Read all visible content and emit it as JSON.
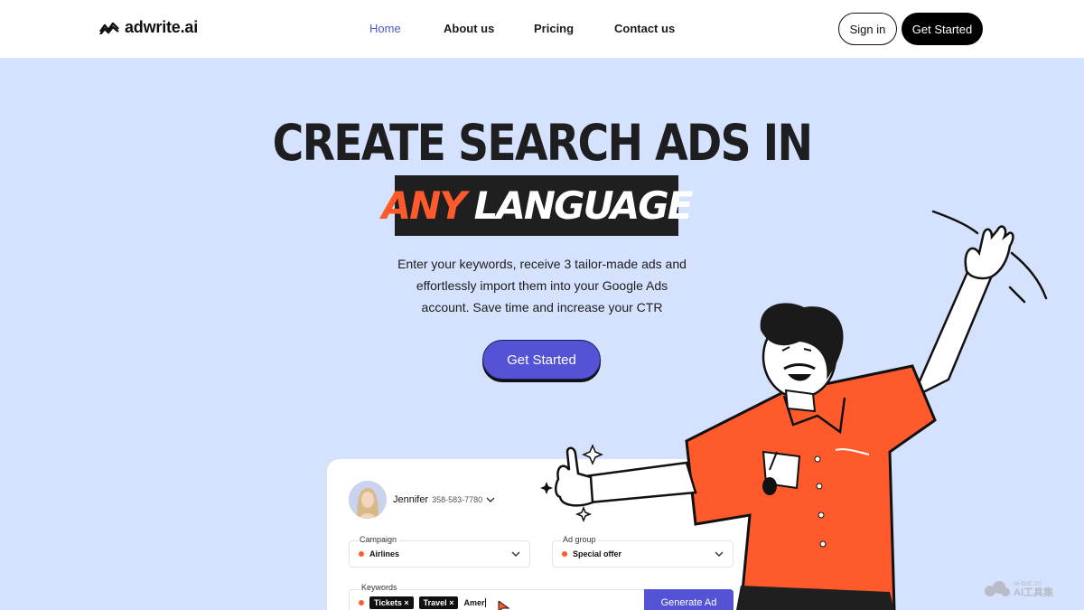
{
  "brand": {
    "name": "adwrite.ai"
  },
  "nav": {
    "links": [
      {
        "label": "Home",
        "active": true
      },
      {
        "label": "About us",
        "active": false
      },
      {
        "label": "Pricing",
        "active": false
      },
      {
        "label": "Contact us",
        "active": false
      }
    ],
    "sign_in": "Sign in",
    "get_started": "Get Started"
  },
  "hero": {
    "title": "CREATE SEARCH ADS IN",
    "highlight_accent": "ANY",
    "highlight_rest": "LANGUAGE",
    "subtitle_lines": [
      "Enter your keywords, receive 3 tailor-made ads and",
      "effortlessly import them into your Google Ads",
      "account. Save time and increase your CTR"
    ],
    "cta": "Get Started"
  },
  "demo": {
    "user": {
      "name": "Jennifer",
      "phone": "358-583-7780"
    },
    "campaign": {
      "label": "Campaign",
      "value": "Airlines"
    },
    "ad_group": {
      "label": "Ad group",
      "value": "Special offer"
    },
    "keywords": {
      "label": "Keywords",
      "tags": [
        "Tickets",
        "Travel"
      ],
      "typed": "Amer"
    },
    "generate": "Generate Ad"
  },
  "watermark": {
    "line1": "ai-bot.cn",
    "line2": "AI工具集"
  },
  "colors": {
    "background": "#d5e2fd",
    "accent_orange": "#ff5a2b",
    "button_purple": "#5453d6",
    "nav_active": "#4a5ad0",
    "dark": "#1f1f1f"
  },
  "icons": [
    "logo-mark-icon",
    "chevron-down-icon",
    "tag-remove-icon",
    "cursor-icon",
    "sparkle-icon"
  ]
}
